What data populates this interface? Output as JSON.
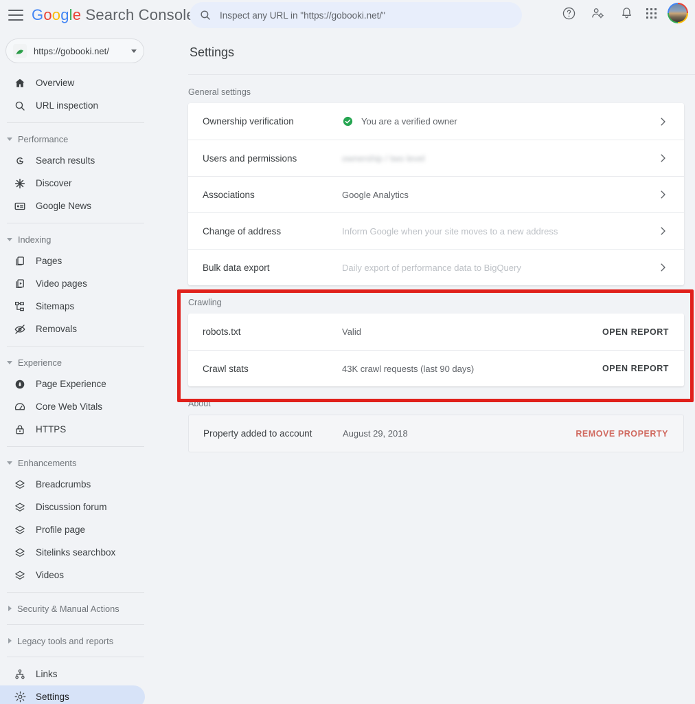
{
  "topbar": {
    "menu_icon": "hamburger-icon",
    "brand": {
      "g": "G",
      "o1": "o",
      "o2": "o",
      "gg": "g",
      "l": "l",
      "e": "e",
      "product": "Search Console"
    },
    "search": {
      "placeholder": "Inspect any URL in \"https://gobooki.net/\"",
      "value": "",
      "icon": "search-icon"
    },
    "icons": [
      {
        "name": "help-icon",
        "label": "Help"
      },
      {
        "name": "account-settings-icon",
        "label": "Account settings"
      },
      {
        "name": "notifications-bell-icon",
        "label": "Notifications"
      },
      {
        "name": "google-apps-grid-icon",
        "label": "Google apps"
      },
      {
        "name": "avatar",
        "label": "Account"
      }
    ]
  },
  "sidebar": {
    "property": {
      "label": "https://gobooki.net/",
      "icon": "site-favicon",
      "caret": "chevron-down-icon"
    },
    "items": [
      {
        "label": "Overview",
        "icon": "home-icon",
        "type": "item",
        "active": false
      },
      {
        "label": "URL inspection",
        "icon": "search-icon",
        "type": "item",
        "active": false
      },
      {
        "label": "Performance",
        "icon": "chevron-down-icon",
        "type": "group",
        "expanded": true
      },
      {
        "label": "Search results",
        "icon": "google-g-icon",
        "type": "item",
        "active": false
      },
      {
        "label": "Discover",
        "icon": "discover-star-icon",
        "type": "item",
        "active": false
      },
      {
        "label": "Google News",
        "icon": "news-card-icon",
        "type": "item",
        "active": false
      },
      {
        "label": "Indexing",
        "icon": "chevron-down-icon",
        "type": "group",
        "expanded": true
      },
      {
        "label": "Pages",
        "icon": "pages-copy-icon",
        "type": "item",
        "active": false
      },
      {
        "label": "Video pages",
        "icon": "video-page-icon",
        "type": "item",
        "active": false
      },
      {
        "label": "Sitemaps",
        "icon": "sitemap-tree-icon",
        "type": "item",
        "active": false
      },
      {
        "label": "Removals",
        "icon": "eye-off-icon",
        "type": "item",
        "active": false
      },
      {
        "label": "Experience",
        "icon": "chevron-down-icon",
        "type": "group",
        "expanded": true
      },
      {
        "label": "Page Experience",
        "icon": "page-experience-icon",
        "type": "item",
        "active": false
      },
      {
        "label": "Core Web Vitals",
        "icon": "speedometer-icon",
        "type": "item",
        "active": false
      },
      {
        "label": "HTTPS",
        "icon": "lock-icon",
        "type": "item",
        "active": false
      },
      {
        "label": "Enhancements",
        "icon": "chevron-down-icon",
        "type": "group",
        "expanded": true
      },
      {
        "label": "Breadcrumbs",
        "icon": "layers-icon",
        "type": "item",
        "active": false
      },
      {
        "label": "Discussion forum",
        "icon": "layers-icon",
        "type": "item",
        "active": false
      },
      {
        "label": "Profile page",
        "icon": "layers-icon",
        "type": "item",
        "active": false
      },
      {
        "label": "Sitelinks searchbox",
        "icon": "layers-icon",
        "type": "item",
        "active": false
      },
      {
        "label": "Videos",
        "icon": "layers-icon",
        "type": "item",
        "active": false
      },
      {
        "label": "Security & Manual Actions",
        "icon": "chevron-right-icon",
        "type": "group",
        "expanded": false
      },
      {
        "label": "Legacy tools and reports",
        "icon": "chevron-right-icon",
        "type": "group",
        "expanded": false
      },
      {
        "label": "Links",
        "icon": "links-graph-icon",
        "type": "item",
        "active": false
      },
      {
        "label": "Settings",
        "icon": "gear-icon",
        "type": "item",
        "active": true
      }
    ]
  },
  "main": {
    "page_title": "Settings",
    "sections": [
      {
        "label": "General settings",
        "rows": [
          {
            "name": "Ownership verification",
            "value": "You are a verified owner",
            "value_state": "normal",
            "status_icon": "check-circle-green-icon",
            "trailing": "chevron-right-icon"
          },
          {
            "name": "Users and permissions",
            "value": "",
            "value_state": "redacted",
            "redacted_text": "ownership / two level",
            "status_icon": "",
            "trailing": "chevron-right-icon"
          },
          {
            "name": "Associations",
            "value": "Google Analytics",
            "value_state": "normal",
            "status_icon": "",
            "trailing": "chevron-right-icon"
          },
          {
            "name": "Change of address",
            "value": "Inform Google when your site moves to a new address",
            "value_state": "muted",
            "status_icon": "",
            "trailing": "chevron-right-icon"
          },
          {
            "name": "Bulk data export",
            "value": "Daily export of performance data to BigQuery",
            "value_state": "muted",
            "status_icon": "",
            "trailing": "chevron-right-icon"
          }
        ]
      },
      {
        "label": "Crawling",
        "highlighted": true,
        "rows": [
          {
            "name": "robots.txt",
            "value": "Valid",
            "value_state": "normal",
            "status_icon": "",
            "trailing": "OPEN REPORT",
            "trailing_type": "action"
          },
          {
            "name": "Crawl stats",
            "value": "43K crawl requests (last 90 days)",
            "value_state": "normal",
            "status_icon": "",
            "trailing": "OPEN REPORT",
            "trailing_type": "action"
          }
        ]
      },
      {
        "label": "About",
        "tinted": true,
        "rows": [
          {
            "name": "Property added to account",
            "value": "August 29, 2018",
            "value_state": "normal",
            "status_icon": "",
            "trailing": "REMOVE PROPERTY",
            "trailing_type": "action-danger"
          }
        ]
      }
    ]
  },
  "colors": {
    "page_bg": "#f1f3f6",
    "card_bg": "#ffffff",
    "accent_blue": "#4285f4",
    "active_pill": "#d7e3f8",
    "status_green": "#1e8e3e",
    "danger_red": "#d0695f",
    "highlight_box_red": "#e0201b",
    "text_primary": "#3c4043",
    "text_secondary": "#5f6368",
    "text_muted": "#bdc1c6"
  }
}
